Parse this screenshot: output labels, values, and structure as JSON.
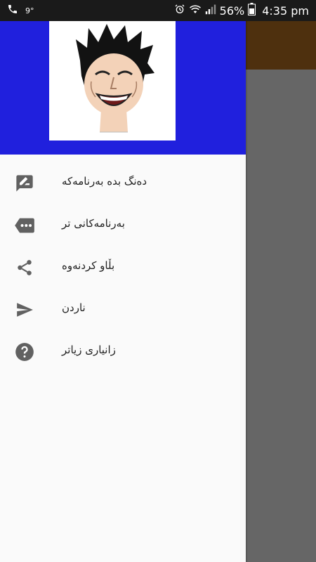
{
  "status_bar": {
    "left_icons": [
      "phone-icon"
    ],
    "temperature": "9°",
    "right_icons": [
      "alarm-icon",
      "wifi-icon",
      "signal-icon",
      "battery-icon"
    ],
    "battery_percent": "56%",
    "time": "4:35 pm"
  },
  "colors": {
    "drawer_header": "#2020dd",
    "app_toolbar": "#4e300e",
    "scrim": "#666666",
    "icon": "#616161"
  },
  "drawer": {
    "header_image": "laughing-face-meme",
    "items": [
      {
        "label": "دەنگ بدە بەرنامەکە",
        "icon": "rate-feedback-icon"
      },
      {
        "label": "بەرنامەکانی تر",
        "icon": "more-apps-icon"
      },
      {
        "label": "بڵاو کردنەوە",
        "icon": "share-icon"
      },
      {
        "label": "ناردن",
        "icon": "send-icon"
      },
      {
        "label": "زانیاری زیاتر",
        "icon": "help-icon"
      }
    ]
  }
}
